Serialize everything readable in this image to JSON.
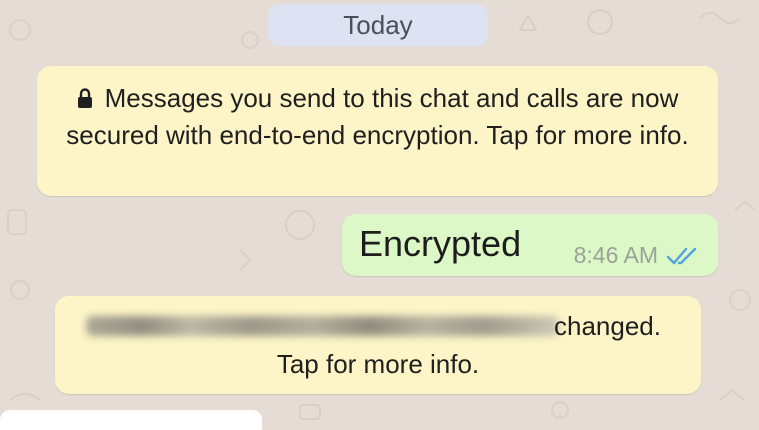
{
  "colors": {
    "background": "#e5ddd5",
    "date_pill": "#dde3f3",
    "system_notice": "#fdf5c7",
    "outgoing_bubble": "#dcf8c6",
    "read_ticks": "#4fa3e0"
  },
  "date_divider": "Today",
  "encryption_notice": {
    "icon": "lock-icon",
    "text": "Messages you send to this chat and calls are now secured with end-to-end encryption. Tap for more info."
  },
  "outgoing_message": {
    "text": "Encrypted",
    "time": "8:46 AM",
    "status_icon": "double-check-read-icon"
  },
  "security_code_notice": {
    "visible_text": "changed.",
    "tap_text": "Tap for more info."
  }
}
